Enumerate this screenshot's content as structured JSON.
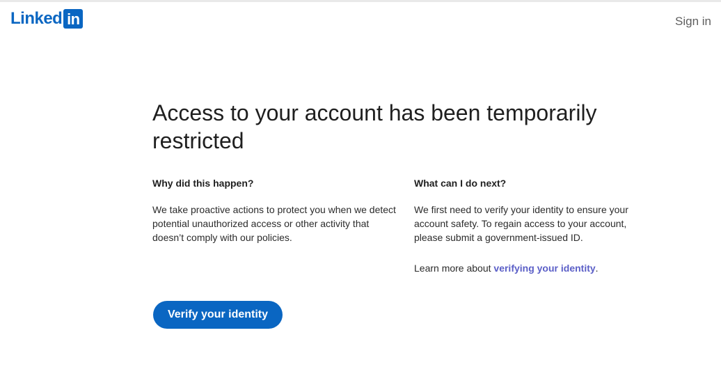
{
  "brand": {
    "logo_word": "Linked",
    "logo_box": "in",
    "color": "#0a66c2"
  },
  "header": {
    "sign_in_label": "Sign in"
  },
  "main": {
    "headline": "Access to your account has been temporarily restricted",
    "why": {
      "heading": "Why did this happen?",
      "body": "We take proactive actions to protect you when we detect potential unauthorized access or other activity that doesn’t comply with our policies."
    },
    "next": {
      "heading": "What can I do next?",
      "body": "We first need to verify your identity to ensure your account safety. To regain access to your account, please submit a government-issued ID.",
      "learn_prefix": "Learn more about ",
      "learn_link": "verifying your identity",
      "learn_suffix": "."
    },
    "verify_button_label": "Verify your identity"
  }
}
